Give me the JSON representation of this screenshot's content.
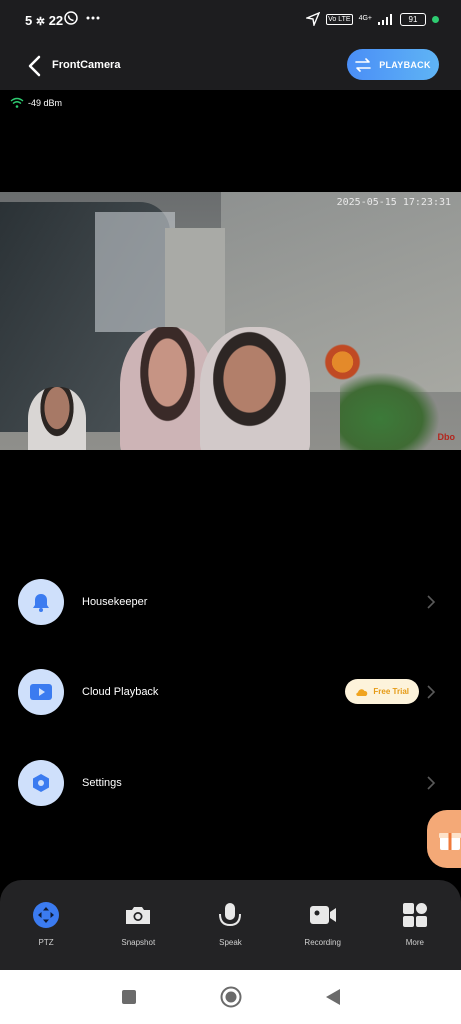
{
  "status_bar": {
    "time": "5",
    "time_rest": "22",
    "volte": "Vo LTE",
    "network": "4G+",
    "battery": "91",
    "icons": [
      "snowflake-icon",
      "whatsapp-icon",
      "more-dots-icon",
      "location-icon",
      "signal-icon",
      "battery-icon"
    ]
  },
  "header": {
    "title": "FrontCamera",
    "playback_label": "PLAYBACK"
  },
  "signal": {
    "strength": "-49 dBm"
  },
  "video": {
    "timestamp": "2025-05-15 17:23:31",
    "watermark": "Dbo"
  },
  "menu": [
    {
      "label": "Housekeeper",
      "icon": "bell-icon"
    },
    {
      "label": "Cloud Playback",
      "icon": "play-icon",
      "badge": "Free Trial"
    },
    {
      "label": "Settings",
      "icon": "hexagon-gear-icon"
    }
  ],
  "tabs": [
    {
      "label": "PTZ",
      "icon": "ptz-icon"
    },
    {
      "label": "Snapshot",
      "icon": "camera-icon"
    },
    {
      "label": "Speak",
      "icon": "microphone-icon"
    },
    {
      "label": "Recording",
      "icon": "video-record-icon"
    },
    {
      "label": "More",
      "icon": "grid-icon"
    }
  ],
  "colors": {
    "accent": "#4a8ef6",
    "icon_bg": "#cfe0fb",
    "badge_text": "#e59a15",
    "status_green": "#2ecc71"
  }
}
